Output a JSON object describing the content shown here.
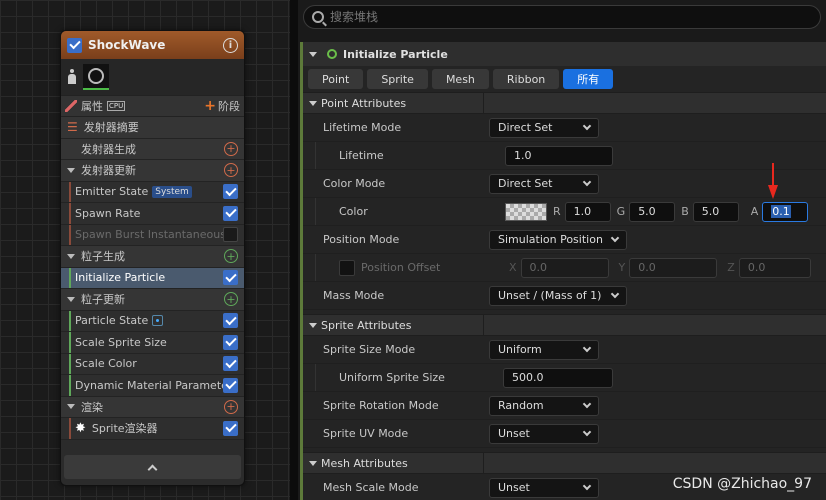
{
  "node": {
    "title": "ShockWave",
    "props_label": "属性",
    "cpu_label": "CPU",
    "stage_label": "阶段",
    "rows": [
      {
        "kind": "cat-plain",
        "label": "发射器摘要"
      },
      {
        "kind": "cat-add",
        "label": "发射器生成",
        "accent": "#d06a4a"
      },
      {
        "kind": "cat-add-tri",
        "label": "发射器更新",
        "accent": "#d06a4a"
      },
      {
        "kind": "item",
        "label": "Emitter State",
        "badge": "System",
        "checked": true,
        "bar": "#8a4a3a"
      },
      {
        "kind": "item",
        "label": "Spawn Rate",
        "checked": true,
        "bar": "#8a4a3a"
      },
      {
        "kind": "item-dim",
        "label": "Spawn Burst Instantaneous",
        "checked": false,
        "bar": "#8a4a3a"
      },
      {
        "kind": "cat-add-tri",
        "label": "粒子生成",
        "accent": "#5fa85a"
      },
      {
        "kind": "item-sel",
        "label": "Initialize Particle",
        "checked": true,
        "bar": "#5fa85a"
      },
      {
        "kind": "cat-add-tri",
        "label": "粒子更新",
        "accent": "#5fa85a"
      },
      {
        "kind": "item",
        "label": "Particle State",
        "dot": true,
        "checked": true,
        "bar": "#5fa85a"
      },
      {
        "kind": "item",
        "label": "Scale Sprite Size",
        "checked": true,
        "bar": "#5fa85a"
      },
      {
        "kind": "item",
        "label": "Scale Color",
        "checked": true,
        "bar": "#5fa85a"
      },
      {
        "kind": "item",
        "label": "Dynamic Material Parameters",
        "checked": true,
        "bar": "#5fa85a"
      },
      {
        "kind": "cat-add-tri",
        "label": "渲染",
        "accent": "#d06a4a"
      },
      {
        "kind": "item-sprite",
        "label": "Sprite渲染器",
        "checked": true,
        "bar": "#8a4a3a"
      }
    ]
  },
  "search": {
    "placeholder": "搜索堆栈"
  },
  "section": {
    "title": "Initialize Particle"
  },
  "tabs": [
    "Point",
    "Sprite",
    "Mesh",
    "Ribbon",
    "所有"
  ],
  "active_tab": 4,
  "groups": {
    "point": {
      "title": "Point Attributes",
      "lifetime_mode": {
        "label": "Lifetime Mode",
        "value": "Direct Set"
      },
      "lifetime": {
        "label": "Lifetime",
        "value": "1.0"
      },
      "color_mode": {
        "label": "Color Mode",
        "value": "Direct Set"
      },
      "color": {
        "label": "Color",
        "r": "1.0",
        "g": "5.0",
        "b": "5.0",
        "a": "0.1"
      },
      "position_mode": {
        "label": "Position Mode",
        "value": "Simulation Position"
      },
      "position_offset": {
        "label": "Position Offset",
        "x": "0.0",
        "y": "0.0",
        "z": "0.0"
      },
      "mass_mode": {
        "label": "Mass Mode",
        "value": "Unset / (Mass of 1)"
      }
    },
    "sprite": {
      "title": "Sprite Attributes",
      "size_mode": {
        "label": "Sprite Size Mode",
        "value": "Uniform"
      },
      "uniform_size": {
        "label": "Uniform Sprite Size",
        "value": "500.0"
      },
      "rotation_mode": {
        "label": "Sprite Rotation Mode",
        "value": "Random"
      },
      "uv_mode": {
        "label": "Sprite UV Mode",
        "value": "Unset"
      }
    },
    "mesh": {
      "title": "Mesh Attributes",
      "scale_mode": {
        "label": "Mesh Scale Mode",
        "value": "Unset"
      }
    }
  },
  "axes": {
    "r": "R",
    "g": "G",
    "b": "B",
    "a": "A",
    "x": "X",
    "y": "Y",
    "z": "Z"
  },
  "watermark": "CSDN @Zhichao_97",
  "colors": {
    "accent": "#1a70e0",
    "node_header": "#a05a2a",
    "annotation_arrow": "#e8281e"
  }
}
